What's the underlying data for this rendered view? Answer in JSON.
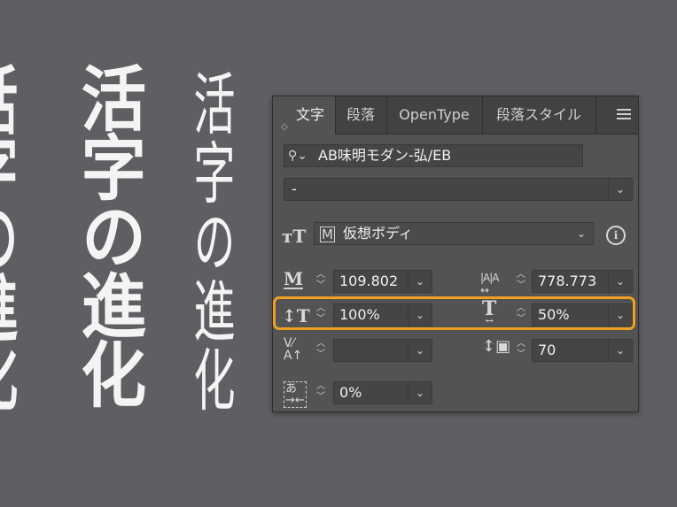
{
  "canvas": {
    "columns": [
      {
        "text": "活字の進化"
      },
      {
        "text": "活字の進化"
      },
      {
        "text": "活字の進化"
      }
    ]
  },
  "panel": {
    "tabs": [
      {
        "label": "文字",
        "active": true
      },
      {
        "label": "段落",
        "active": false
      },
      {
        "label": "OpenType",
        "active": false
      },
      {
        "label": "段落スタイル",
        "active": false
      }
    ],
    "font_family": "AB味明モダン-弘/EB",
    "font_style": "-",
    "text_frame_type": "仮想ボディ",
    "font_size": "109.802",
    "leading": "778.773",
    "vertical_scale": "100%",
    "horizontal_scale": "50%",
    "kerning": "",
    "tracking": "70",
    "tsume": "0%"
  },
  "colors": {
    "canvas_bg": "#5f5e62",
    "panel_bg": "#535353",
    "highlight": "#f0a020"
  }
}
